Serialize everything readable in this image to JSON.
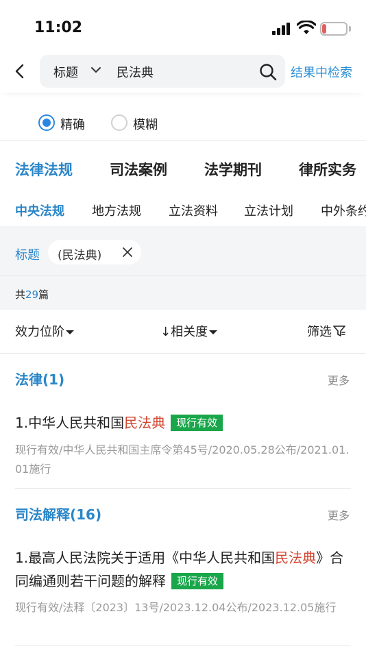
{
  "status_bar": {
    "time": "11:02",
    "battery": "17",
    "battery_percent": 17
  },
  "search": {
    "field_type": "标题",
    "value": "民法典",
    "search_in_results": "结果中检索"
  },
  "match_mode": {
    "options": [
      {
        "label": "精确",
        "selected": true
      },
      {
        "label": "模糊",
        "selected": false
      }
    ]
  },
  "category_tabs": [
    {
      "label": "法律法规",
      "active": true
    },
    {
      "label": "司法案例",
      "active": false
    },
    {
      "label": "法学期刊",
      "active": false
    },
    {
      "label": "律所实务",
      "active": false
    }
  ],
  "sub_tabs": [
    {
      "label": "中央法规",
      "active": true
    },
    {
      "label": "地方法规",
      "active": false
    },
    {
      "label": "立法资料",
      "active": false
    },
    {
      "label": "立法计划",
      "active": false
    },
    {
      "label": "中外条约",
      "active": false
    }
  ],
  "filter": {
    "label": "标题",
    "chip": "(民法典)"
  },
  "count": {
    "prefix": "共",
    "number": "29",
    "suffix": "篇"
  },
  "sort": {
    "effect_level": "效力位阶",
    "relevance": "↓相关度",
    "filter": "筛选"
  },
  "sections": [
    {
      "header": "法律(1)",
      "more": "更多",
      "item": {
        "title_prefix": "1.中华人民共和国",
        "title_highlight": "民法典",
        "title_suffix": "",
        "status": "现行有效",
        "meta": "现行有效/中华人民共和国主席令第45号/2020.05.28公布/2021.01.01施行"
      }
    },
    {
      "header": "司法解释(16)",
      "more": "更多",
      "item": {
        "title_prefix": "1.最高人民法院关于适用《中华人民共和国",
        "title_highlight": "民法典",
        "title_suffix": "》合同编通则若干问题的解释",
        "status": "现行有效",
        "meta": "现行有效/法释〔2023〕13号/2023.12.04公布/2023.12.05施行"
      }
    }
  ],
  "colors": {
    "accent": "#2a86c8",
    "highlight": "#d2452f",
    "status_green": "#1aa64a"
  }
}
